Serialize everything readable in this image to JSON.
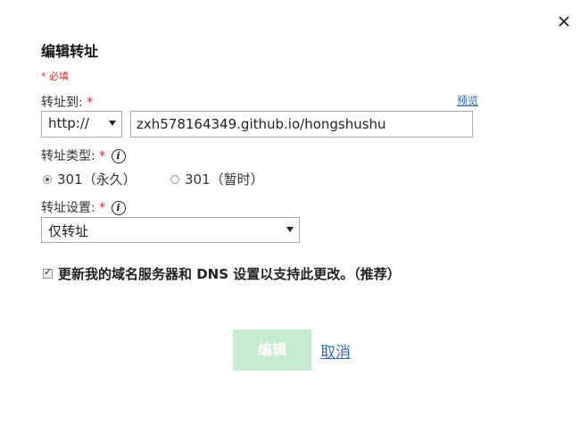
{
  "dialog": {
    "title": "编辑转址",
    "required_note": "* 必填",
    "close_icon": "close-icon"
  },
  "forward_to": {
    "label": "转址到:",
    "required_mark": "*",
    "preview_link": "预览",
    "protocol": "http://",
    "url_value": "zxh578164349.github.io/hongshushu"
  },
  "forward_type": {
    "label": "转址类型:",
    "required_mark": "*",
    "info_icon": "info-icon",
    "options": [
      {
        "label": "301（永久）",
        "selected": true
      },
      {
        "label": "301（暂时）",
        "selected": false
      }
    ]
  },
  "forward_settings": {
    "label": "转址设置:",
    "required_mark": "*",
    "info_icon": "info-icon",
    "selected": "仅转址"
  },
  "dns_update": {
    "checked": true,
    "label": "更新我的域名服务器和 DNS 设置以支持此更改。（推荐）"
  },
  "actions": {
    "edit_label": "编辑",
    "cancel_label": "取消",
    "edit_color": "#c6ebd1",
    "cancel_color": "#3a6fb5"
  }
}
